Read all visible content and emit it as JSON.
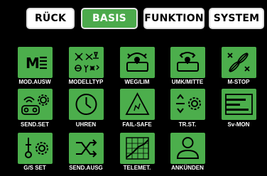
{
  "tabs": [
    {
      "label": "RÜCK",
      "active": false
    },
    {
      "label": "BASIS",
      "active": true
    },
    {
      "label": "FUNKTION",
      "active": false
    },
    {
      "label": "SYSTEM",
      "active": false
    }
  ],
  "menu": {
    "row1": [
      "MOD.AUSW",
      "MODELLTYP",
      "WEG/LIM",
      "UMK/MITTE",
      "M-STOP"
    ],
    "row2": [
      "SEND.SET",
      "UHREN",
      "FAIL-SAFE",
      "TR.ST.",
      "Sv-MON"
    ],
    "row3": [
      "G/S SET",
      "SEND.AUSG",
      "TELEMET.",
      "ANKÜNDEN"
    ],
    "mod_glyph": "M"
  },
  "colors": {
    "accent": "#4cae4c",
    "background": "#000000",
    "tab_bg": "#ffffff"
  }
}
